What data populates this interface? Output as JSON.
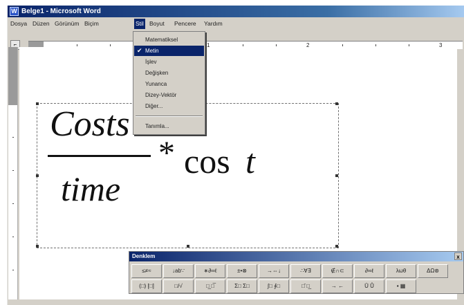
{
  "window": {
    "title": "Belge1 - Microsoft Word",
    "app_icon": "word-icon"
  },
  "menubar": {
    "items": [
      {
        "label": "Dosya"
      },
      {
        "label": "Düzen"
      },
      {
        "label": "Görünüm"
      },
      {
        "label": "Biçim"
      },
      {
        "label": "Stil"
      },
      {
        "label": "Boyut"
      },
      {
        "label": "Pencere"
      },
      {
        "label": "Yardım"
      }
    ]
  },
  "ruler": {
    "numbers": [
      "1",
      "2",
      "3"
    ]
  },
  "style_menu": {
    "items": [
      {
        "label": "Matematiksel",
        "checked": false
      },
      {
        "label": "Metin",
        "checked": true
      },
      {
        "label": "İşlev",
        "checked": false
      },
      {
        "label": "Değişken",
        "checked": false
      },
      {
        "label": "Yunanca",
        "checked": false
      },
      {
        "label": "Dizey-Vektör",
        "checked": false
      },
      {
        "label": "Diğer...",
        "checked": false
      },
      {
        "label": "Tanımla...",
        "checked": false
      }
    ],
    "check_mark": "✔"
  },
  "equation": {
    "numerator": "Costs",
    "denominator": "time",
    "operator": "*",
    "function": "cos",
    "variable": "t"
  },
  "equation_toolbar": {
    "title": "Denklem",
    "close_label": "x",
    "row1": [
      "≤≠≈",
      "↓ab∵",
      "∗∂∞ℓ",
      "±•⊗",
      "→⇔↓",
      "∴∀∃",
      "∉∩⊂",
      "∂∞ℓ",
      "λωθ",
      "ΔΩ⊛"
    ],
    "row2": [
      "(□) [□]",
      "□/√",
      "□̲ □̅",
      "Σ□ Σ□",
      "∫□ ∮□",
      "□̄ □̲",
      "→ ←",
      "Ū Ů",
      "▪ ▦"
    ]
  }
}
